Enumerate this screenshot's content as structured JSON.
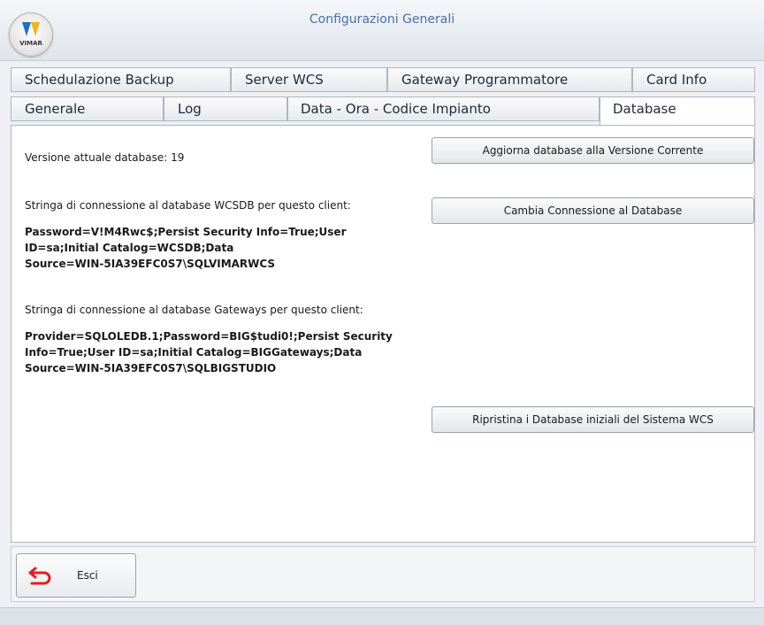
{
  "window": {
    "title": "Configurazioni Generali",
    "logo_text": "VIMAR"
  },
  "tabs": {
    "row1": [
      {
        "label": "Schedulazione Backup"
      },
      {
        "label": "Server WCS"
      },
      {
        "label": "Gateway Programmatore"
      },
      {
        "label": "Card Info"
      }
    ],
    "row2": [
      {
        "label": "Generale"
      },
      {
        "label": "Log"
      },
      {
        "label": "Data - Ora - Codice Impianto"
      },
      {
        "label": "Database",
        "active": true
      }
    ]
  },
  "database": {
    "version_label": "Versione attuale database: 19",
    "wcsdb_label": "Stringa di connessione al database WCSDB per questo client:",
    "wcsdb_line1": "Password=V!M4Rwc$;Persist Security Info=True;User",
    "wcsdb_line2": "ID=sa;Initial Catalog=WCSDB;Data",
    "wcsdb_line3": "Source=WIN-5IA39EFC0S7\\SQLVIMARWCS",
    "gateways_label": "Stringa di connessione al database Gateways per questo client:",
    "gateways_line1": "Provider=SQLOLEDB.1;Password=BIG$tudi0!;Persist Security",
    "gateways_line2": "Info=True;User ID=sa;Initial Catalog=BIGGateways;Data",
    "gateways_line3": "Source=WIN-5IA39EFC0S7\\SQLBIGSTUDIO",
    "buttons": {
      "update": "Aggiorna database alla Versione Corrente",
      "change": "Cambia Connessione al Database",
      "restore": "Ripristina i Database iniziali del Sistema WCS"
    }
  },
  "footer": {
    "exit_label": "Esci"
  },
  "colors": {
    "title": "#4a6fa5",
    "exit_arrow": "#e02020"
  }
}
